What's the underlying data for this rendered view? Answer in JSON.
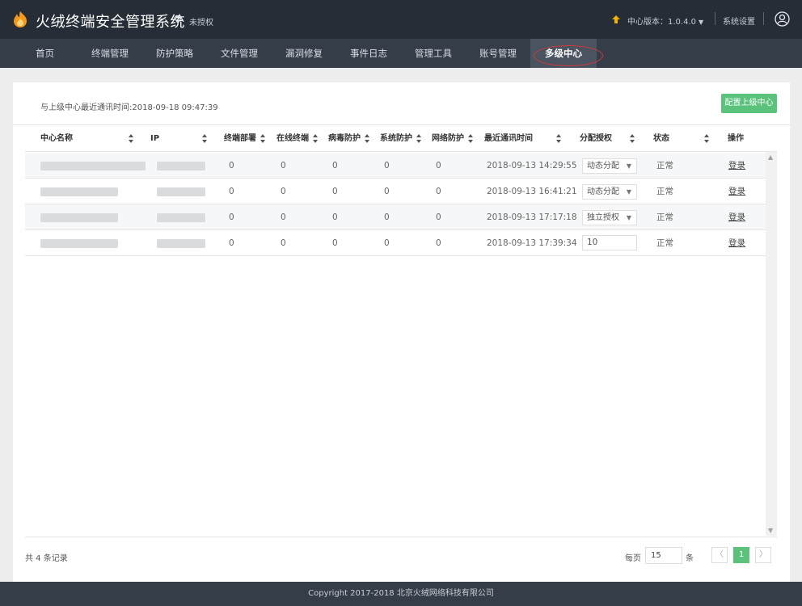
{
  "header": {
    "app_title": "火绒终端安全管理系统",
    "license_status": "未授权",
    "version_label": "中心版本：1.0.4.0",
    "settings_label": "系统设置"
  },
  "nav": {
    "items": [
      "首页",
      "终端管理",
      "防护策略",
      "文件管理",
      "漏洞修复",
      "事件日志",
      "管理工具",
      "账号管理",
      "多级中心"
    ],
    "active_index": 8
  },
  "panel": {
    "last_sync_text": "与上级中心最近通讯时间:2018-09-18 09:47:39",
    "config_button": "配置上级中心"
  },
  "table": {
    "columns": [
      "中心名称",
      "IP",
      "终端部署",
      "在线终端",
      "病毒防护",
      "系统防护",
      "网络防护",
      "最近通讯时间",
      "分配授权",
      "状态",
      "操作"
    ],
    "rows": [
      {
        "terminals": "0",
        "online": "0",
        "virus": "0",
        "system": "0",
        "network": "0",
        "last_comm": "2018-09-13 14:29:55",
        "auth": "动态分配",
        "status": "正常",
        "action": "登录"
      },
      {
        "terminals": "0",
        "online": "0",
        "virus": "0",
        "system": "0",
        "network": "0",
        "last_comm": "2018-09-13 16:41:21",
        "auth": "动态分配",
        "status": "正常",
        "action": "登录"
      },
      {
        "terminals": "0",
        "online": "0",
        "virus": "0",
        "system": "0",
        "network": "0",
        "last_comm": "2018-09-13 17:17:18",
        "auth": "独立授权",
        "status": "正常",
        "action": "登录"
      },
      {
        "terminals": "0",
        "online": "0",
        "virus": "0",
        "system": "0",
        "network": "0",
        "last_comm": "2018-09-13 17:39:34",
        "auth_value": "10",
        "status": "正常",
        "action": "登录"
      }
    ]
  },
  "pagination": {
    "total_text": "共 4 条记录",
    "per_page_label": "每页",
    "per_page_value": "15",
    "per_page_unit": "条",
    "prev": "〈",
    "current_page": "1",
    "next": "〉"
  },
  "footer": {
    "copyright": "Copyright 2017-2018 北京火绒网络科技有限公司"
  },
  "colors": {
    "topbar": "#262d36",
    "navbar": "#353d48",
    "accent_green": "#5bc27c",
    "logo_orange": "#f39a1c",
    "highlight_red": "#d23a3a"
  }
}
